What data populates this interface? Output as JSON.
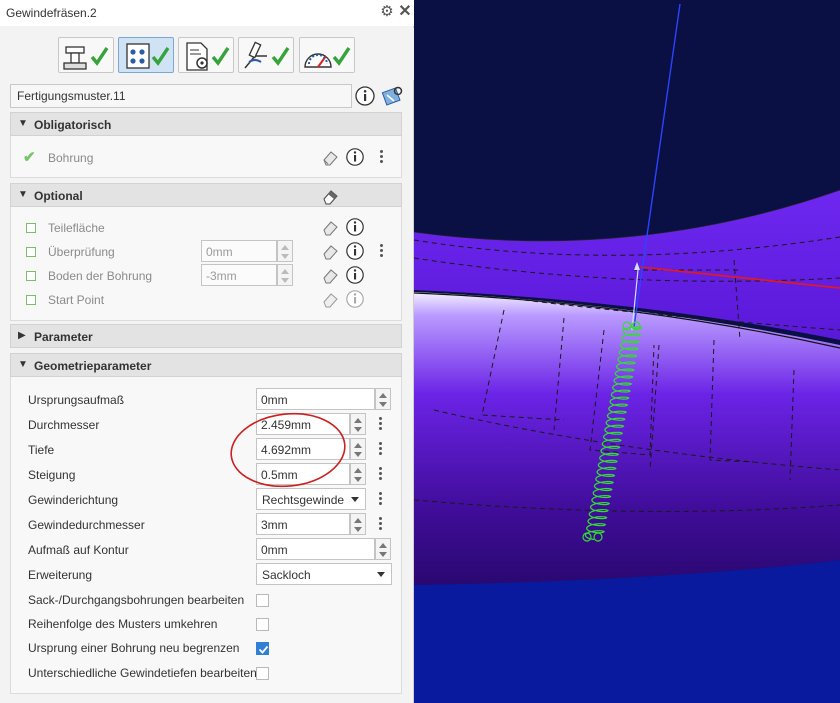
{
  "window": {
    "title": "Gewindefräsen.2",
    "gear_icon": "gear-icon",
    "close_icon": "close-icon"
  },
  "toolbar": {
    "tabs": [
      {
        "name": "machine-tab",
        "icon": "machine-tool-icon",
        "checked": true
      },
      {
        "name": "geometry-tab",
        "icon": "geometry-icon",
        "checked": true,
        "active": true
      },
      {
        "name": "parameters-tab",
        "icon": "document-gear-icon",
        "checked": true
      },
      {
        "name": "strategy-tab",
        "icon": "tool-path-icon",
        "checked": true
      },
      {
        "name": "feeds-tab",
        "icon": "gauge-icon",
        "checked": true
      }
    ]
  },
  "pattern": {
    "value": "Fertigungsmuster.11"
  },
  "sections": {
    "mandatory": {
      "label": "Obligatorisch",
      "items": [
        {
          "label": "Bohrung",
          "state": "done"
        }
      ]
    },
    "optional": {
      "label": "Optional",
      "items": [
        {
          "label": "Teilefläche"
        },
        {
          "label": "Überprüfung",
          "value": "0mm"
        },
        {
          "label": "Boden der Bohrung",
          "value": "-3mm"
        },
        {
          "label": "Start Point"
        }
      ]
    },
    "parameter": {
      "label": "Parameter"
    },
    "geometry": {
      "label": "Geometrieparameter",
      "rows": [
        {
          "label": "Ursprungsaufmaß",
          "value": "0mm"
        },
        {
          "label": "Durchmesser",
          "value": "2.459mm"
        },
        {
          "label": "Tiefe",
          "value": "4.692mm"
        },
        {
          "label": "Steigung",
          "value": "0.5mm"
        },
        {
          "label": "Gewinderichtung",
          "value": "Rechtsgewinde"
        },
        {
          "label": "Gewindedurchmesser",
          "value": "3mm"
        },
        {
          "label": "Aufmaß auf Kontur",
          "value": "0mm"
        },
        {
          "label": "Erweiterung",
          "value": "Sackloch"
        }
      ],
      "checks": [
        {
          "label": "Sack-/Durchgangsbohrungen bearbeiten",
          "checked": false
        },
        {
          "label": "Reihenfolge des Musters umkehren",
          "checked": false
        },
        {
          "label": "Ursprung einer Bohrung neu begrenzen",
          "checked": true
        },
        {
          "label": "Unterschiedliche Gewindetiefen bearbeiten",
          "checked": false
        }
      ]
    }
  },
  "colors": {
    "accent": "#2f7fd6",
    "check": "#78c46a",
    "highlight_circle": "#cc1f1f",
    "part_purple": "#6a22e6",
    "helix_green": "#33dd33",
    "tool_axis": "#2244ff"
  }
}
